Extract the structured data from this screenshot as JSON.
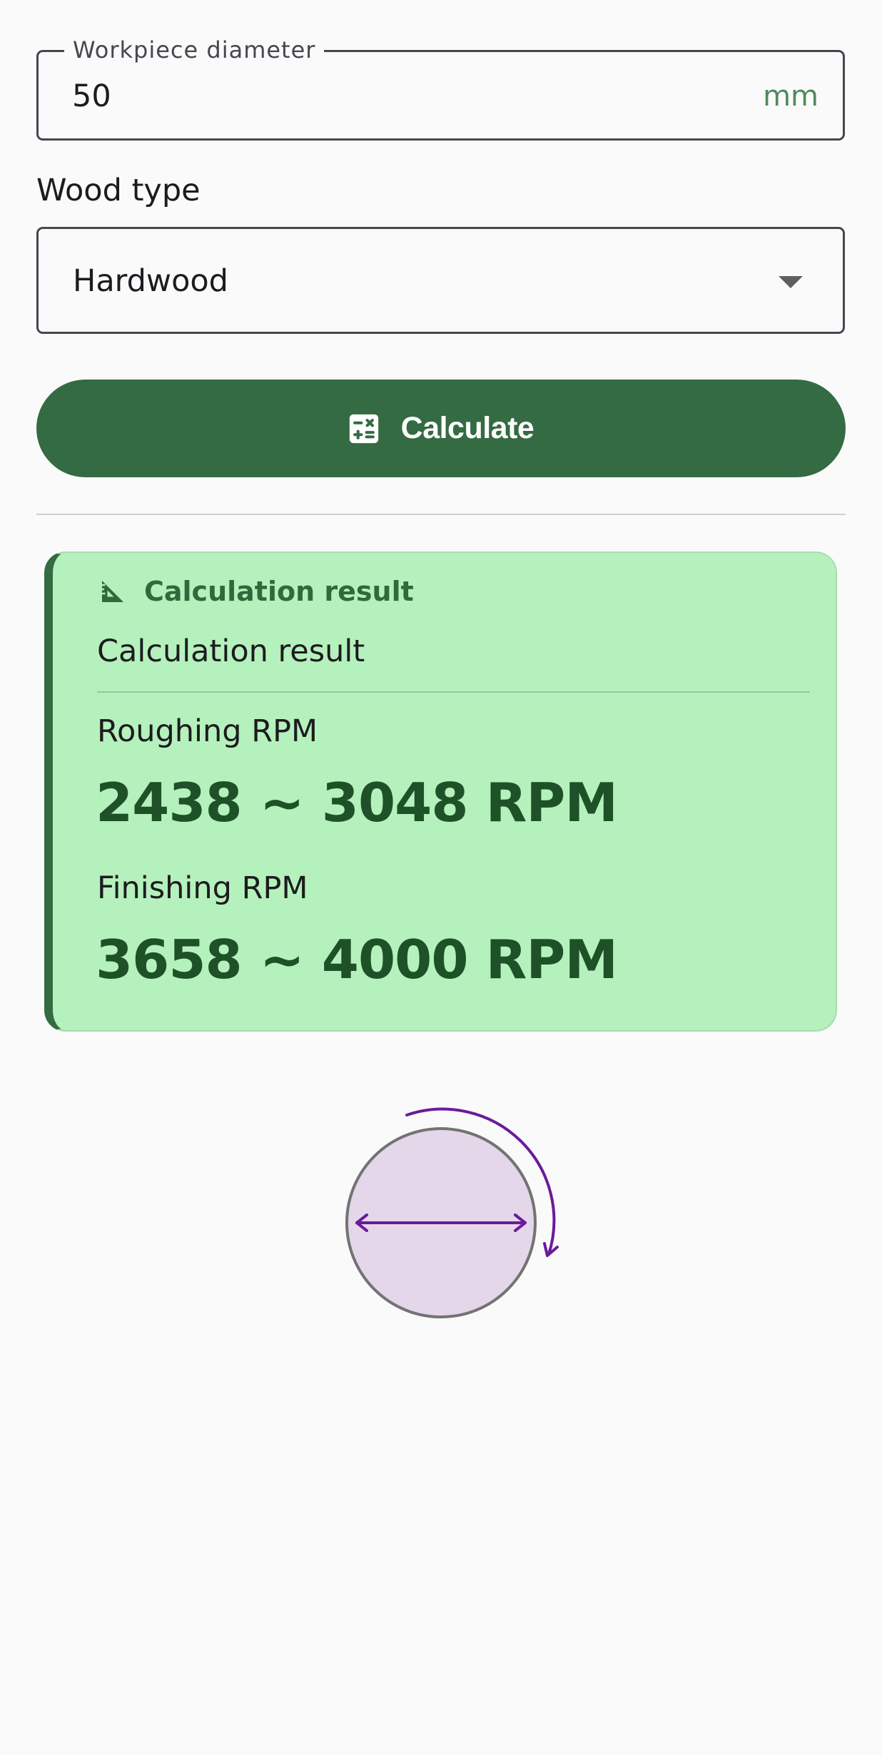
{
  "diameter_field": {
    "label": "Workpiece diameter",
    "value": "50",
    "suffix": "mm"
  },
  "wood_type": {
    "label": "Wood type",
    "selected": "Hardwood"
  },
  "calculate_button": {
    "label": "Calculate",
    "icon": "calculator-icon",
    "color": "#346b42"
  },
  "result": {
    "header_icon": "ruler-square-icon",
    "header_label": "Calculation result",
    "subtitle": "Calculation result",
    "roughing_label": "Roughing RPM",
    "roughing_value": "2438 ~ 3048 RPM",
    "finishing_label": "Finishing RPM",
    "finishing_value": "3658 ~ 4000 RPM",
    "background_color": "#b5f1bc",
    "accent_color": "#346b42"
  },
  "diagram": {
    "icon": "rotating-workpiece-diagram"
  }
}
